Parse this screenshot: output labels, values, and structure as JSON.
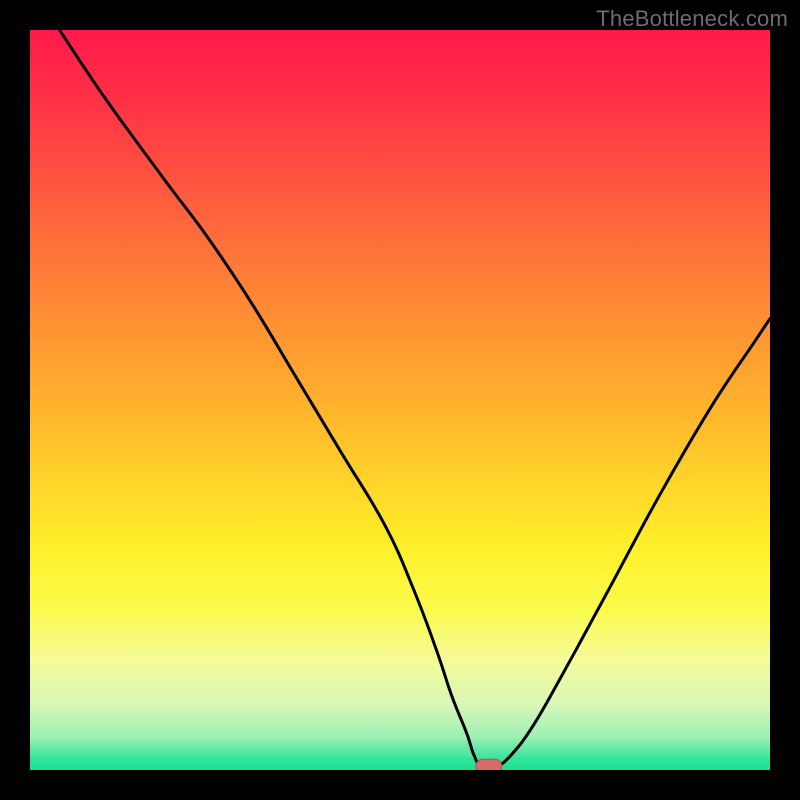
{
  "watermark": "TheBottleneck.com",
  "colors": {
    "black": "#000000",
    "line": "#000000",
    "marker_fill": "#d86a6a",
    "marker_stroke": "#c24d4d",
    "gradient_stops": [
      {
        "offset": 0.0,
        "color": "#ff1a4a"
      },
      {
        "offset": 0.1,
        "color": "#ff3247"
      },
      {
        "offset": 0.22,
        "color": "#ff5a3f"
      },
      {
        "offset": 0.35,
        "color": "#ff8336"
      },
      {
        "offset": 0.48,
        "color": "#ffaa2e"
      },
      {
        "offset": 0.6,
        "color": "#ffd129"
      },
      {
        "offset": 0.7,
        "color": "#fff029"
      },
      {
        "offset": 0.78,
        "color": "#fbfb4a"
      },
      {
        "offset": 0.85,
        "color": "#f6fb97"
      },
      {
        "offset": 0.91,
        "color": "#d9f7b6"
      },
      {
        "offset": 0.955,
        "color": "#9ef0b4"
      },
      {
        "offset": 0.985,
        "color": "#33e59c"
      },
      {
        "offset": 1.0,
        "color": "#17df91"
      }
    ]
  },
  "chart_data": {
    "type": "line",
    "title": "",
    "xlabel": "",
    "ylabel": "",
    "xlim": [
      0,
      100
    ],
    "ylim": [
      0,
      100
    ],
    "x": [
      4,
      10,
      18,
      24,
      30,
      36,
      42,
      48,
      52,
      55,
      57,
      59,
      60,
      61,
      63,
      65,
      68,
      72,
      78,
      85,
      92,
      98,
      100
    ],
    "values": [
      100,
      91,
      80,
      72,
      63,
      53,
      43,
      33,
      24,
      16,
      10,
      5,
      2,
      0.5,
      0.5,
      2,
      6,
      13,
      24,
      37,
      49,
      58,
      61
    ],
    "marker": {
      "x": 62,
      "y": 0.5
    }
  }
}
